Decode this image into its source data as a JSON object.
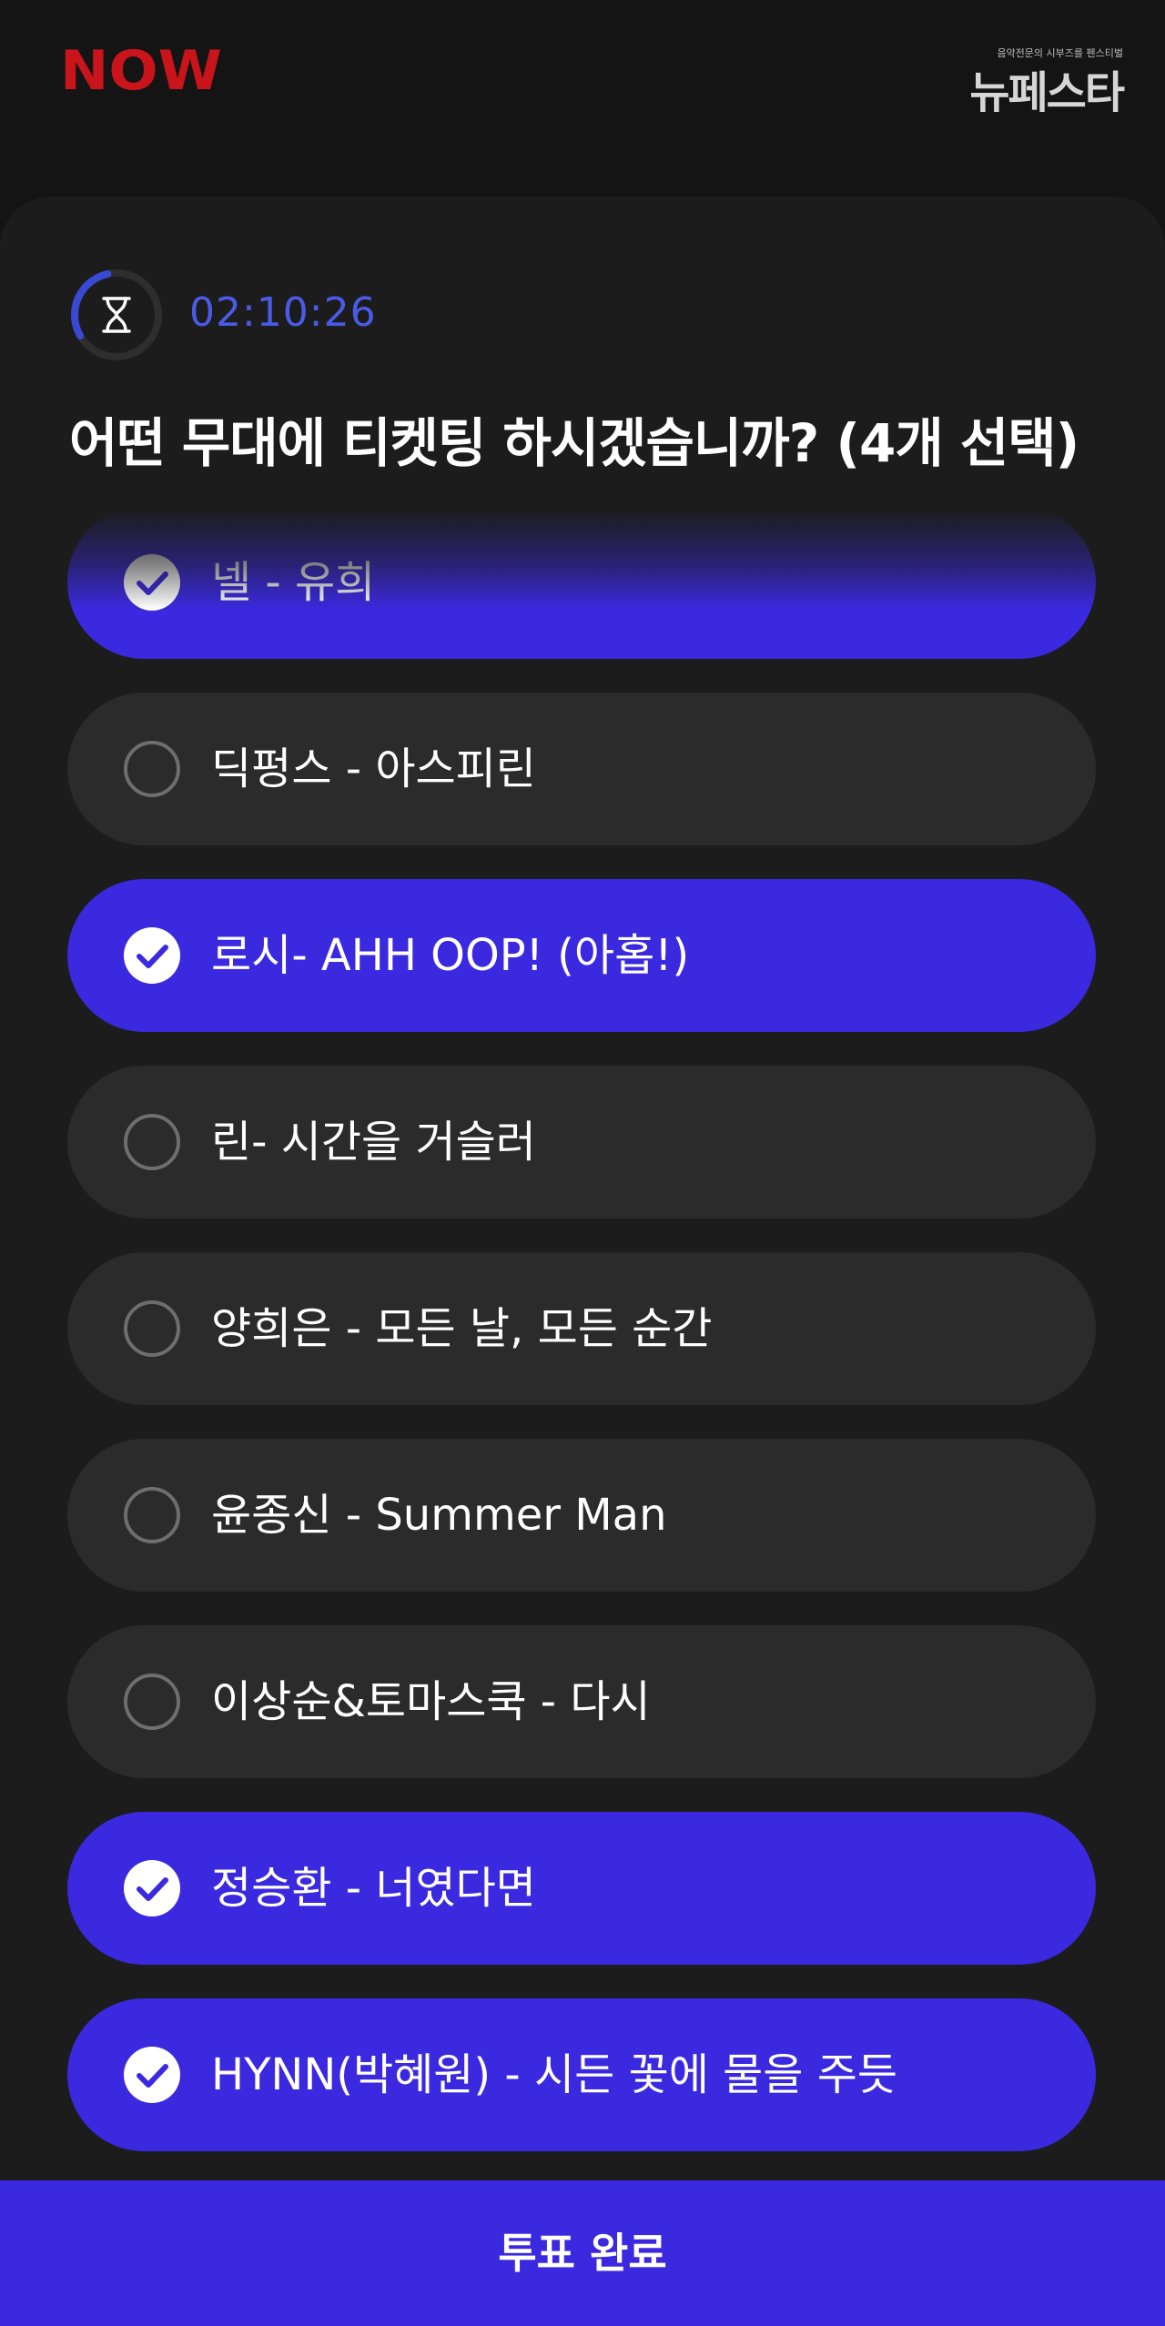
{
  "header": {
    "logo_text": "NOW",
    "brand_tagline": "음악전문의 시부즈를 펜스티벌",
    "brand_name": "뉴페스타",
    "logo_color": "#c8141a"
  },
  "timer": {
    "time": "02:10:26",
    "progress_fraction": 0.3,
    "accent": "#4b5be8",
    "icon": "hourglass-icon"
  },
  "question": "어떤 무대에 티켓팅 하시겠습니까? (4개 선택)",
  "options": [
    {
      "label": "넬 - 유희",
      "selected": true
    },
    {
      "label": "딕펑스 - 아스피린",
      "selected": false
    },
    {
      "label": "로시- AHH OOP! (아홉!)",
      "selected": true
    },
    {
      "label": "린- 시간을 거슬러",
      "selected": false
    },
    {
      "label": "양희은 - 모든 날, 모든 순간",
      "selected": false
    },
    {
      "label": "윤종신 - Summer Man",
      "selected": false
    },
    {
      "label": "이상순&토마스쿡 - 다시",
      "selected": false
    },
    {
      "label": "정승환 - 너였다면",
      "selected": true
    },
    {
      "label": "HYNN(박혜원) - 시든 꽃에 물을 주듯",
      "selected": true
    }
  ],
  "submit_label": "투표 완료",
  "colors": {
    "background": "#141414",
    "card": "#1c1c1c",
    "option_unselected": "#2b2b2b",
    "option_selected": "#3a29de",
    "button": "#3a29de"
  }
}
